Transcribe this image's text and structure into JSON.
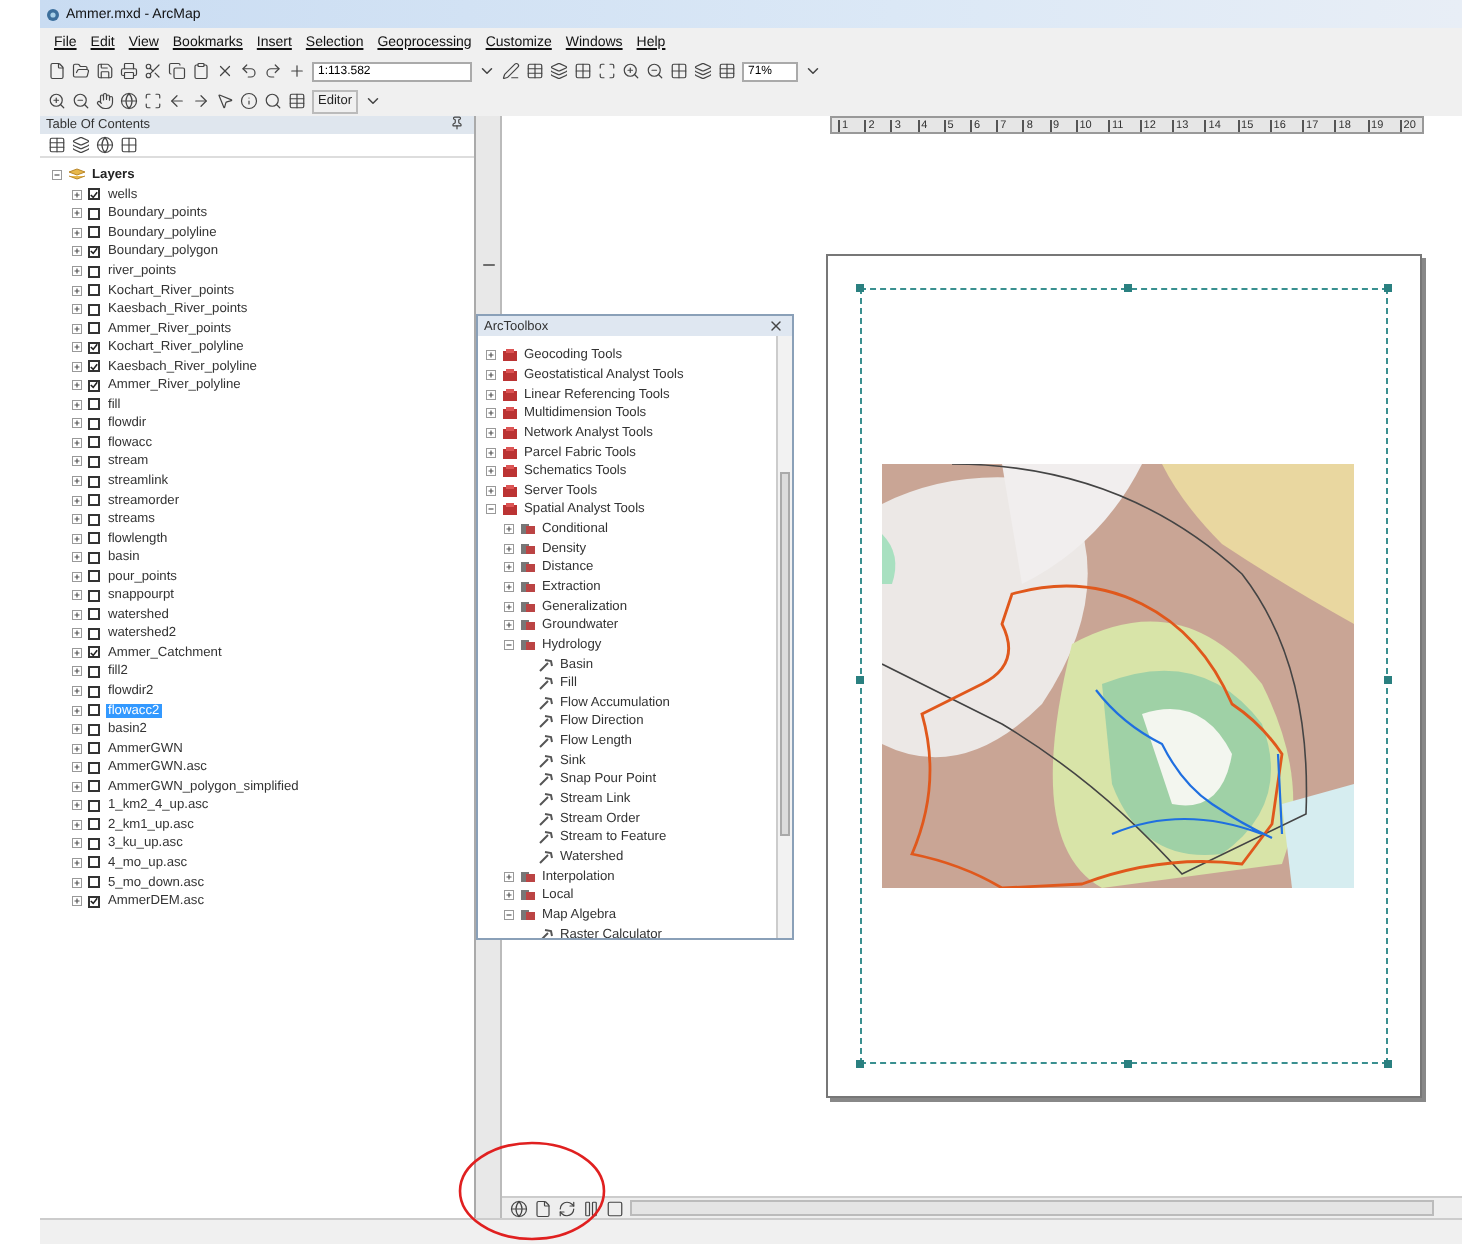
{
  "window": {
    "title": "Ammer.mxd - ArcMap"
  },
  "menu": [
    "File",
    "Edit",
    "View",
    "Bookmarks",
    "Insert",
    "Selection",
    "Geoprocessing",
    "Customize",
    "Windows",
    "Help"
  ],
  "toolbar": {
    "scale": "1:113.582",
    "zoom": "71%",
    "editor": "Editor"
  },
  "toc": {
    "title": "Table Of Contents",
    "root": {
      "name": "Layers",
      "expanded": true,
      "children": [
        {
          "name": "wells",
          "checked": true,
          "selected": false
        },
        {
          "name": "Boundary_points",
          "checked": false,
          "selected": false
        },
        {
          "name": "Boundary_polyline",
          "checked": false,
          "selected": false
        },
        {
          "name": "Boundary_polygon",
          "checked": true,
          "selected": false
        },
        {
          "name": "river_points",
          "checked": false,
          "selected": false
        },
        {
          "name": "Kochart_River_points",
          "checked": false,
          "selected": false
        },
        {
          "name": "Kaesbach_River_points",
          "checked": false,
          "selected": false
        },
        {
          "name": "Ammer_River_points",
          "checked": false,
          "selected": false
        },
        {
          "name": "Kochart_River_polyline",
          "checked": true,
          "selected": false
        },
        {
          "name": "Kaesbach_River_polyline",
          "checked": true,
          "selected": false
        },
        {
          "name": "Ammer_River_polyline",
          "checked": true,
          "selected": false
        },
        {
          "name": "fill",
          "checked": false,
          "selected": false
        },
        {
          "name": "flowdir",
          "checked": false,
          "selected": false
        },
        {
          "name": "flowacc",
          "checked": false,
          "selected": false
        },
        {
          "name": "stream",
          "checked": false,
          "selected": false
        },
        {
          "name": "streamlink",
          "checked": false,
          "selected": false
        },
        {
          "name": "streamorder",
          "checked": false,
          "selected": false
        },
        {
          "name": "streams",
          "checked": false,
          "selected": false
        },
        {
          "name": "flowlength",
          "checked": false,
          "selected": false
        },
        {
          "name": "basin",
          "checked": false,
          "selected": false
        },
        {
          "name": "pour_points",
          "checked": false,
          "selected": false
        },
        {
          "name": "snappourpt",
          "checked": false,
          "selected": false
        },
        {
          "name": "watershed",
          "checked": false,
          "selected": false
        },
        {
          "name": "watershed2",
          "checked": false,
          "selected": false
        },
        {
          "name": "Ammer_Catchment",
          "checked": true,
          "selected": false
        },
        {
          "name": "fill2",
          "checked": false,
          "selected": false
        },
        {
          "name": "flowdir2",
          "checked": false,
          "selected": false
        },
        {
          "name": "flowacc2",
          "checked": false,
          "selected": true
        },
        {
          "name": "basin2",
          "checked": false,
          "selected": false
        },
        {
          "name": "AmmerGWN",
          "checked": false,
          "selected": false
        },
        {
          "name": "AmmerGWN.asc",
          "checked": false,
          "selected": false
        },
        {
          "name": "AmmerGWN_polygon_simplified",
          "checked": false,
          "selected": false
        },
        {
          "name": "1_km2_4_up.asc",
          "checked": false,
          "selected": false
        },
        {
          "name": "2_km1_up.asc",
          "checked": false,
          "selected": false
        },
        {
          "name": "3_ku_up.asc",
          "checked": false,
          "selected": false
        },
        {
          "name": "4_mo_up.asc",
          "checked": false,
          "selected": false
        },
        {
          "name": "5_mo_down.asc",
          "checked": false,
          "selected": false
        },
        {
          "name": "AmmerDEM.asc",
          "checked": true,
          "selected": false
        }
      ]
    }
  },
  "ruler": [
    "1",
    "2",
    "3",
    "4",
    "5",
    "6",
    "7",
    "8",
    "9",
    "10",
    "11",
    "12",
    "13",
    "14",
    "15",
    "16",
    "17",
    "18",
    "19",
    "20"
  ],
  "toolbox": {
    "title": "ArcToolbox",
    "items": [
      {
        "kind": "toolbox",
        "name": "Geocoding Tools",
        "expanded": false
      },
      {
        "kind": "toolbox",
        "name": "Geostatistical Analyst Tools",
        "expanded": false
      },
      {
        "kind": "toolbox",
        "name": "Linear Referencing Tools",
        "expanded": false
      },
      {
        "kind": "toolbox",
        "name": "Multidimension Tools",
        "expanded": false
      },
      {
        "kind": "toolbox",
        "name": "Network Analyst Tools",
        "expanded": false
      },
      {
        "kind": "toolbox",
        "name": "Parcel Fabric Tools",
        "expanded": false
      },
      {
        "kind": "toolbox",
        "name": "Schematics Tools",
        "expanded": false
      },
      {
        "kind": "toolbox",
        "name": "Server Tools",
        "expanded": false
      },
      {
        "kind": "toolbox",
        "name": "Spatial Analyst Tools",
        "expanded": true,
        "children": [
          {
            "kind": "toolset",
            "name": "Conditional",
            "expanded": false
          },
          {
            "kind": "toolset",
            "name": "Density",
            "expanded": false
          },
          {
            "kind": "toolset",
            "name": "Distance",
            "expanded": false
          },
          {
            "kind": "toolset",
            "name": "Extraction",
            "expanded": false
          },
          {
            "kind": "toolset",
            "name": "Generalization",
            "expanded": false
          },
          {
            "kind": "toolset",
            "name": "Groundwater",
            "expanded": false
          },
          {
            "kind": "toolset",
            "name": "Hydrology",
            "expanded": true,
            "children": [
              {
                "kind": "tool",
                "name": "Basin"
              },
              {
                "kind": "tool",
                "name": "Fill"
              },
              {
                "kind": "tool",
                "name": "Flow Accumulation"
              },
              {
                "kind": "tool",
                "name": "Flow Direction"
              },
              {
                "kind": "tool",
                "name": "Flow Length"
              },
              {
                "kind": "tool",
                "name": "Sink"
              },
              {
                "kind": "tool",
                "name": "Snap Pour Point"
              },
              {
                "kind": "tool",
                "name": "Stream Link"
              },
              {
                "kind": "tool",
                "name": "Stream Order"
              },
              {
                "kind": "tool",
                "name": "Stream to Feature"
              },
              {
                "kind": "tool",
                "name": "Watershed"
              }
            ]
          },
          {
            "kind": "toolset",
            "name": "Interpolation",
            "expanded": false
          },
          {
            "kind": "toolset",
            "name": "Local",
            "expanded": false
          },
          {
            "kind": "toolset",
            "name": "Map Algebra",
            "expanded": true,
            "children": [
              {
                "kind": "tool",
                "name": "Raster Calculator"
              }
            ]
          }
        ]
      }
    ]
  },
  "map": {
    "kind": "picture"
  }
}
